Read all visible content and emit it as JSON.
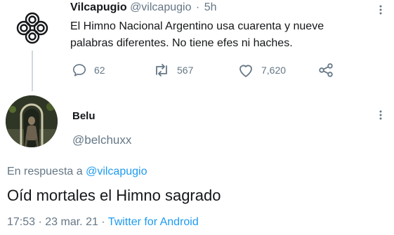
{
  "original_tweet": {
    "display_name": "Vilcapugio",
    "handle": "@vilcapugio",
    "separator": "·",
    "time": "5h",
    "text": "El Himno Nacional Argentino usa cuarenta y nueve palabras diferentes. No tiene efes ni haches.",
    "menu_glyph": "⋮",
    "actions": {
      "replies": "62",
      "retweets": "567",
      "likes": "7,620"
    },
    "avatar_icon": "knot-logo-icon"
  },
  "reply_tweet": {
    "display_name": "Belu",
    "handle": "@belchuxx",
    "menu_glyph": "⋮",
    "replying_to_prefix": "En respuesta a",
    "replying_to_handle": "@vilcapugio",
    "text": "Oíd mortales el Himno sagrado",
    "timestamp": "17:53 · 23 mar. 21 ·",
    "source": "Twitter for Android"
  },
  "colors": {
    "text": "#14171a",
    "secondary": "#657786",
    "accent": "#1d9bf0",
    "thread_line": "#cfd9de"
  }
}
